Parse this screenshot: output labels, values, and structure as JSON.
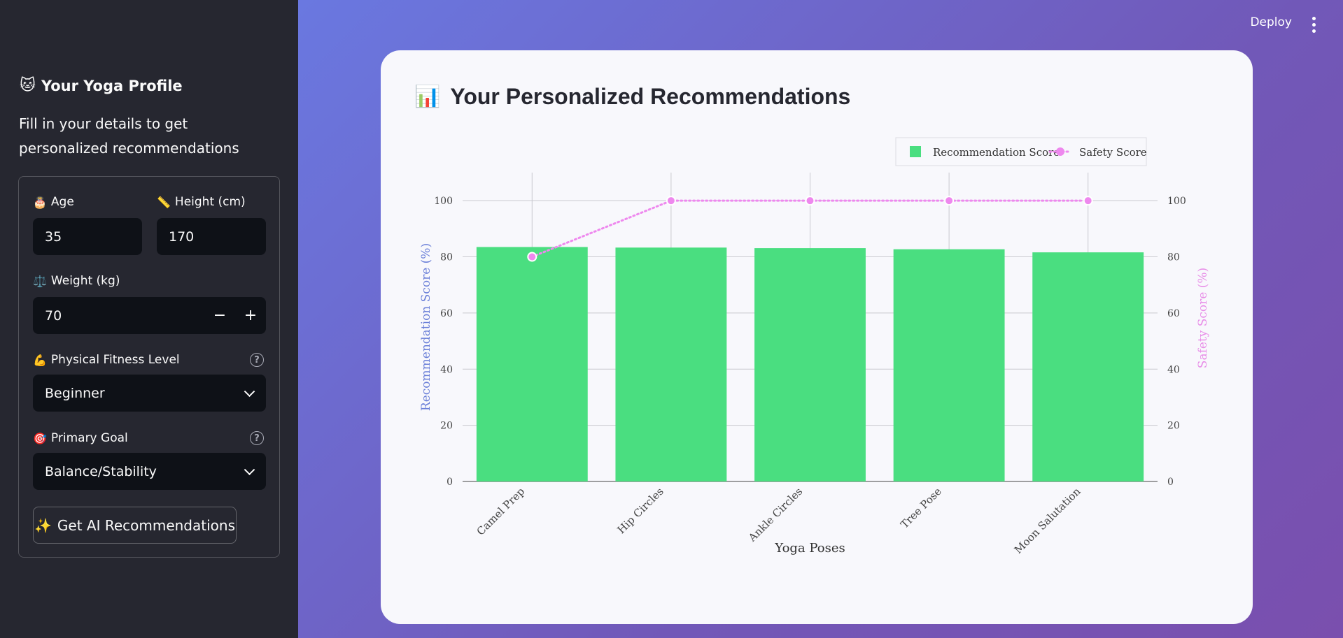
{
  "sidebar": {
    "title": "Your Yoga Profile",
    "title_icon": "cat-face-icon",
    "description": "Fill in your details to get personalized recommendations",
    "age": {
      "label": "Age",
      "icon": "birthday-cake-icon",
      "value": "35"
    },
    "height": {
      "label": "Height (cm)",
      "icon": "ruler-icon",
      "value": "170"
    },
    "weight": {
      "label": "Weight (kg)",
      "icon": "scales-icon",
      "value": "70",
      "minus": "−",
      "plus": "+"
    },
    "fitness": {
      "label": "Physical Fitness Level",
      "icon": "flexed-biceps-icon",
      "value": "Beginner"
    },
    "goal": {
      "label": "Primary Goal",
      "icon": "target-icon",
      "value": "Balance/Stability"
    },
    "button": {
      "label": "Get AI Recommendations",
      "icon": "sparkles-icon"
    },
    "help_glyph": "?"
  },
  "header": {
    "deploy": "Deploy"
  },
  "main": {
    "title": "Your Personalized Recommendations",
    "title_icon": "bar-chart-icon"
  },
  "colors": {
    "bar": "#4ade80",
    "line": "#ee88ee",
    "left_axis": "#6a7fd8",
    "right_axis": "#e88ee8"
  },
  "chart_data": {
    "type": "bar",
    "categories": [
      "Camel Prep",
      "Hip Circles",
      "Ankle Circles",
      "Tree Pose",
      "Moon Salutation"
    ],
    "series": [
      {
        "name": "Recommendation Score",
        "type": "bar",
        "axis": "left",
        "values": [
          83.5,
          83.3,
          83.1,
          82.7,
          81.6
        ]
      },
      {
        "name": "Safety Score",
        "type": "line",
        "axis": "right",
        "values": [
          80,
          100,
          100,
          100,
          100
        ]
      }
    ],
    "xlabel": "Yoga Poses",
    "ylabel": "Recommendation Score (%)",
    "y2label": "Safety Score (%)",
    "ylim": [
      0,
      110
    ],
    "y2lim": [
      0,
      110
    ],
    "yticks": [
      0,
      20,
      40,
      60,
      80,
      100
    ],
    "legend_position": "top-right",
    "grid": true
  }
}
